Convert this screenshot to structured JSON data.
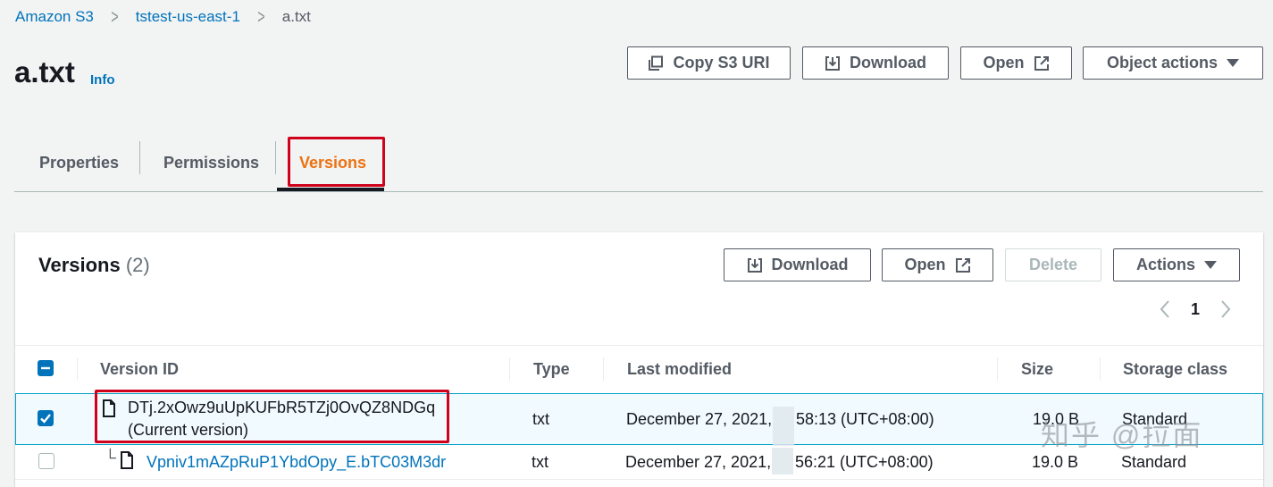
{
  "breadcrumb": {
    "items": [
      "Amazon S3",
      "tstest-us-east-1",
      "a.txt"
    ]
  },
  "header": {
    "title": "a.txt",
    "info_label": "Info"
  },
  "object_actions": {
    "copy_uri_label": "Copy S3 URI",
    "download_label": "Download",
    "open_label": "Open",
    "object_actions_label": "Object actions"
  },
  "tabs": [
    {
      "label": "Properties",
      "active": false
    },
    {
      "label": "Permissions",
      "active": false
    },
    {
      "label": "Versions",
      "active": true
    }
  ],
  "versions_panel": {
    "title": "Versions",
    "count": "(2)",
    "download_label": "Download",
    "open_label": "Open",
    "delete_label": "Delete",
    "actions_label": "Actions",
    "current_page": "1"
  },
  "table": {
    "columns": [
      "Version ID",
      "Type",
      "Last modified",
      "Size",
      "Storage class"
    ],
    "rows": [
      {
        "selected": true,
        "version_id": "DTj.2xOwz9uUpKUFbR5TZj0OvQZ8NDGq",
        "version_note": "(Current version)",
        "type": "txt",
        "last_modified_date": "December 27, 2021,",
        "last_modified_time": "58:13 (UTC+08:00)",
        "size": "19.0 B",
        "storage_class": "Standard"
      },
      {
        "selected": false,
        "version_id": "Vpniv1mAZpRuP1YbdOpy_E.bTC03M3dr",
        "type": "txt",
        "last_modified_date": "December 27, 2021,",
        "last_modified_time": "56:21 (UTC+08:00)",
        "size": "19.0 B",
        "storage_class": "Standard"
      }
    ]
  },
  "watermark": "知乎 @拉面",
  "colors": {
    "link": "#0073bb",
    "active_tab": "#ec7211",
    "highlight_box": "#d0021b",
    "selected_row_bg": "#f1faff",
    "selected_row_border": "#00a1c9"
  }
}
